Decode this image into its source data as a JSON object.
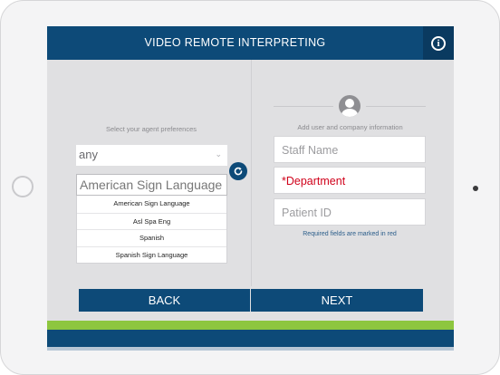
{
  "header": {
    "title": "VIDEO REMOTE INTERPRETING",
    "info_icon": "info-icon"
  },
  "left_panel": {
    "preferences_label": "Select your agent preferences",
    "agent_select": {
      "value": "any"
    },
    "language_input": {
      "value": "American Sign Language"
    },
    "language_options": [
      "American Sign Language",
      "Asl Spa Eng",
      "Spanish",
      "Spanish Sign Language"
    ],
    "refresh_icon": "refresh-icon"
  },
  "right_panel": {
    "user_info_label": "Add user and company information",
    "avatar_icon": "user-avatar-icon",
    "fields": {
      "staff_name_placeholder": "Staff Name",
      "department_placeholder": "*Department",
      "patient_id_placeholder": "Patient ID"
    },
    "required_note": "Required fields are marked in red"
  },
  "footer": {
    "back_label": "BACK",
    "next_label": "NEXT"
  },
  "colors": {
    "primary": "#0d4a78",
    "accent_green": "#8dc63f",
    "required_red": "#d0021b"
  }
}
